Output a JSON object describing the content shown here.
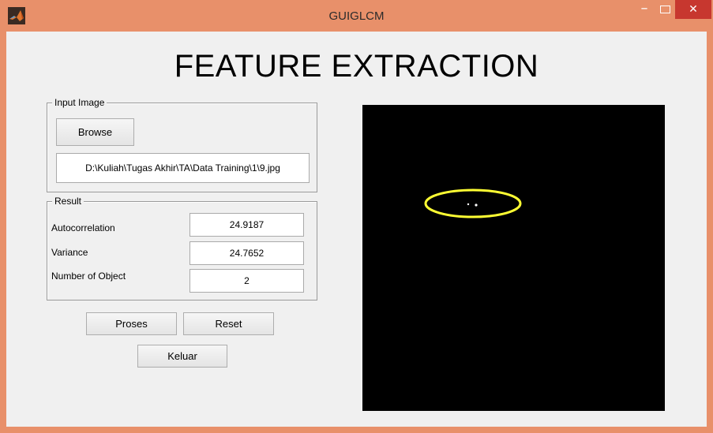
{
  "window": {
    "title": "GUIGLCM",
    "icon": "matlab-icon",
    "controls": {
      "minimize": "–",
      "close": "✕"
    }
  },
  "main": {
    "heading": "FEATURE EXTRACTION"
  },
  "input_panel": {
    "label": "Input Image",
    "browse_label": "Browse",
    "path_value": "D:\\Kuliah\\Tugas Akhir\\TA\\Data Training\\1\\9.jpg"
  },
  "result_panel": {
    "label": "Result",
    "rows": [
      {
        "label": "Autocorrelation",
        "value": "24.9187"
      },
      {
        "label": "Variance",
        "value": "24.7652"
      },
      {
        "label": "Number of Object",
        "value": "2"
      }
    ]
  },
  "actions": {
    "proses_label": "Proses",
    "reset_label": "Reset",
    "keluar_label": "Keluar"
  },
  "image_axes": {
    "background": "#000000",
    "highlight_color": "#ffff33",
    "object_color": "#ffffff"
  }
}
